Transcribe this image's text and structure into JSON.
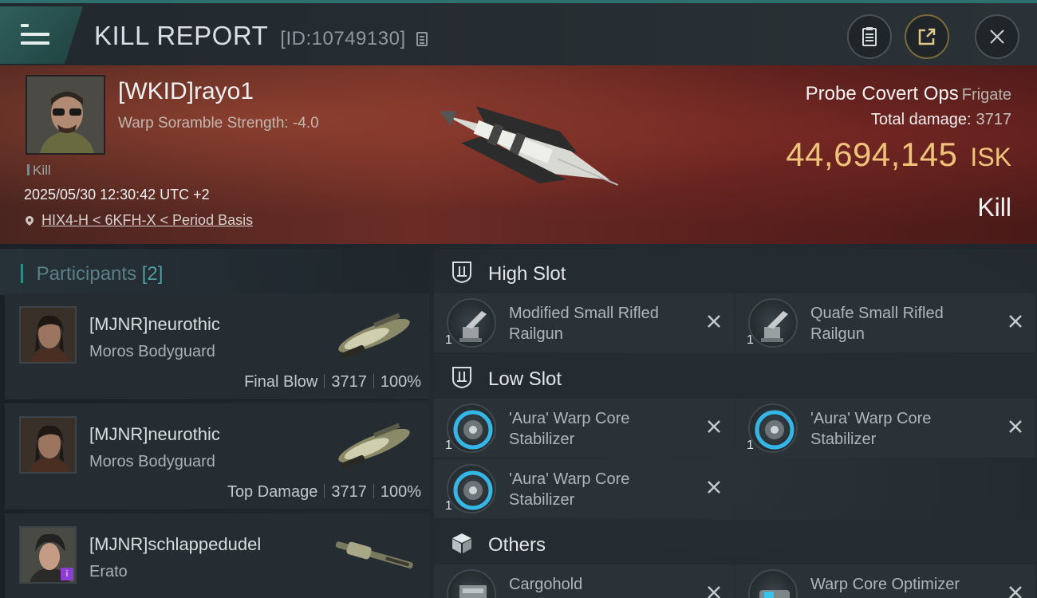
{
  "header": {
    "title": "KILL REPORT",
    "report_id": "[ID:10749130]",
    "icons": [
      "menu-icon",
      "copy-icon",
      "clipboard-icon",
      "share-icon",
      "close-icon"
    ]
  },
  "victim": {
    "pilot": "[WKID]rayo1",
    "scramble": "Warp Soramble Strength: -4.0",
    "tag": "Kill",
    "datetime": "2025/05/30 12:30:42 UTC +2",
    "location": "HIX4-H < 6KFH-X < Period Basis",
    "ship": "Probe Covert Ops",
    "ship_class": "Frigate",
    "total_damage_label": "Total damage:",
    "total_damage": "3717",
    "isk_value": "44,694,145",
    "isk_unit": "ISK",
    "result": "Kill"
  },
  "participants": {
    "label": "Participants",
    "count": "[2]",
    "rows": [
      {
        "name": "[MJNR]neurothic",
        "ship": "Moros Bodyguard",
        "role": "Final Blow",
        "damage": "3717",
        "percent": "100%"
      },
      {
        "name": "[MJNR]neurothic",
        "ship": "Moros Bodyguard",
        "role": "Top Damage",
        "damage": "3717",
        "percent": "100%"
      },
      {
        "name": "[MJNR]schlappedudel",
        "ship": "Erato",
        "badge": "i"
      }
    ]
  },
  "fitting": {
    "high_slot": {
      "label": "High Slot",
      "modules": [
        {
          "name": "Modified Small Rifled Railgun",
          "qty": "1"
        },
        {
          "name": "Quafe Small Rifled Railgun",
          "qty": "1"
        }
      ]
    },
    "low_slot": {
      "label": "Low Slot",
      "modules": [
        {
          "name": "'Aura' Warp Core Stabilizer",
          "qty": "1"
        },
        {
          "name": "'Aura' Warp Core Stabilizer",
          "qty": "1"
        },
        {
          "name": "'Aura' Warp Core Stabilizer",
          "qty": "1"
        }
      ]
    },
    "others": {
      "label": "Others",
      "modules": [
        {
          "name": "Cargohold"
        },
        {
          "name": "Warp Core Optimizer"
        }
      ]
    }
  },
  "colors": {
    "accent_teal": "#2f6f6e",
    "isk_gold": "#f0c37a",
    "hero_red": "#6a2c25"
  }
}
